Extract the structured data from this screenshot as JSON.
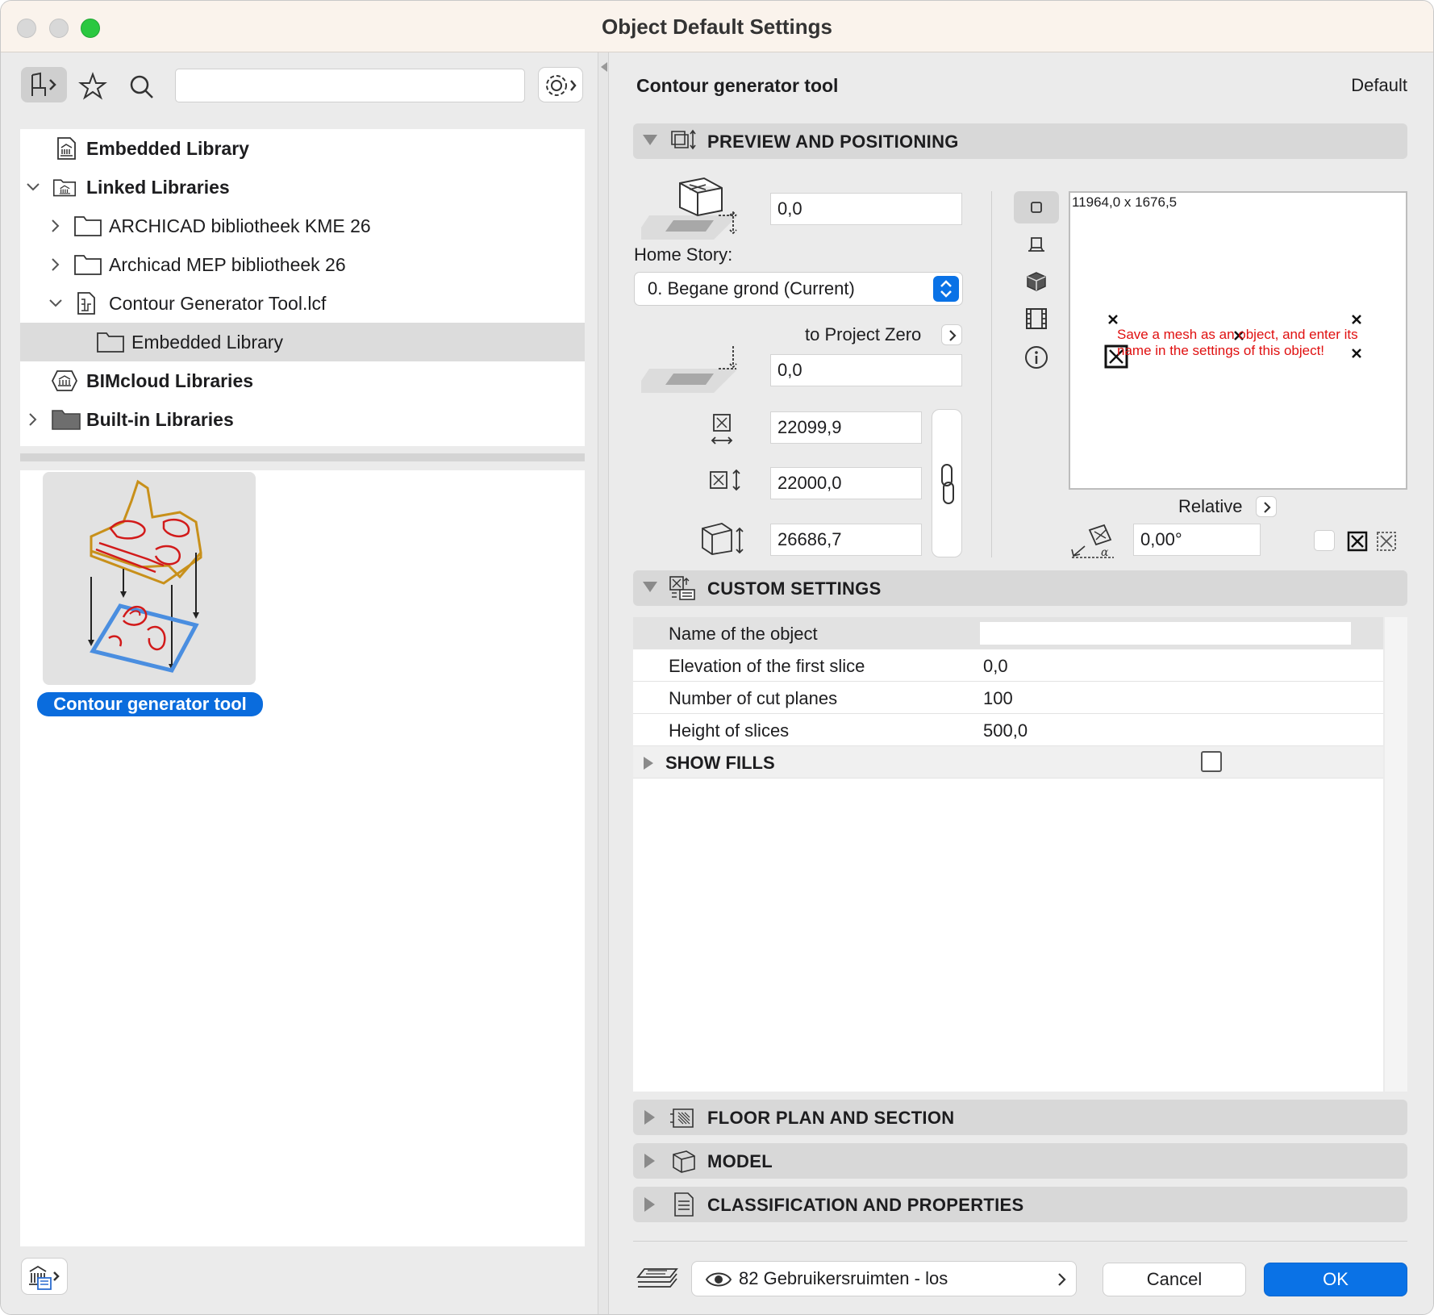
{
  "window": {
    "title": "Object Default Settings"
  },
  "left": {
    "search_placeholder": "",
    "tree": [
      {
        "label": "Embedded Library",
        "bold": true
      },
      {
        "label": "Linked Libraries",
        "bold": true
      },
      {
        "label": "ARCHICAD bibliotheek KME 26",
        "bold": false
      },
      {
        "label": "Archicad MEP bibliotheek 26",
        "bold": false
      },
      {
        "label": "Contour Generator Tool.lcf",
        "bold": false
      },
      {
        "label": "Embedded Library",
        "bold": false
      },
      {
        "label": "BIMcloud Libraries",
        "bold": true
      },
      {
        "label": "Built-in Libraries",
        "bold": true
      }
    ],
    "selected_item": "Contour generator tool"
  },
  "right": {
    "object_name": "Contour generator tool",
    "default_label": "Default",
    "sections": {
      "preview": "PREVIEW AND POSITIONING",
      "custom": "CUSTOM SETTINGS",
      "floor_plan": "FLOOR PLAN AND SECTION",
      "model": "MODEL",
      "classification": "CLASSIFICATION AND PROPERTIES"
    },
    "preview": {
      "elevation_to_story": "0,0",
      "home_story_label": "Home Story:",
      "home_story_value": "0. Begane grond (Current)",
      "to_project_zero": "to Project Zero",
      "elevation_to_zero": "0,0",
      "width": "22099,9",
      "depth": "22000,0",
      "height": "26686,7",
      "preview_dims": "11964,0 x 1676,5",
      "preview_message": "Save a mesh as an object, and enter its name in the settings of this object!",
      "relative_label": "Relative",
      "rotation": "0,00°"
    },
    "custom": {
      "rows": [
        {
          "key": "Name of the object",
          "value": ""
        },
        {
          "key": "Elevation of the first slice",
          "value": "0,0"
        },
        {
          "key": "Number of cut planes",
          "value": "100"
        },
        {
          "key": "Height of slices",
          "value": "500,0"
        }
      ],
      "group": "SHOW FILLS"
    },
    "footer": {
      "layer": "82 Gebruikersruimten - los",
      "cancel": "Cancel",
      "ok": "OK"
    }
  }
}
